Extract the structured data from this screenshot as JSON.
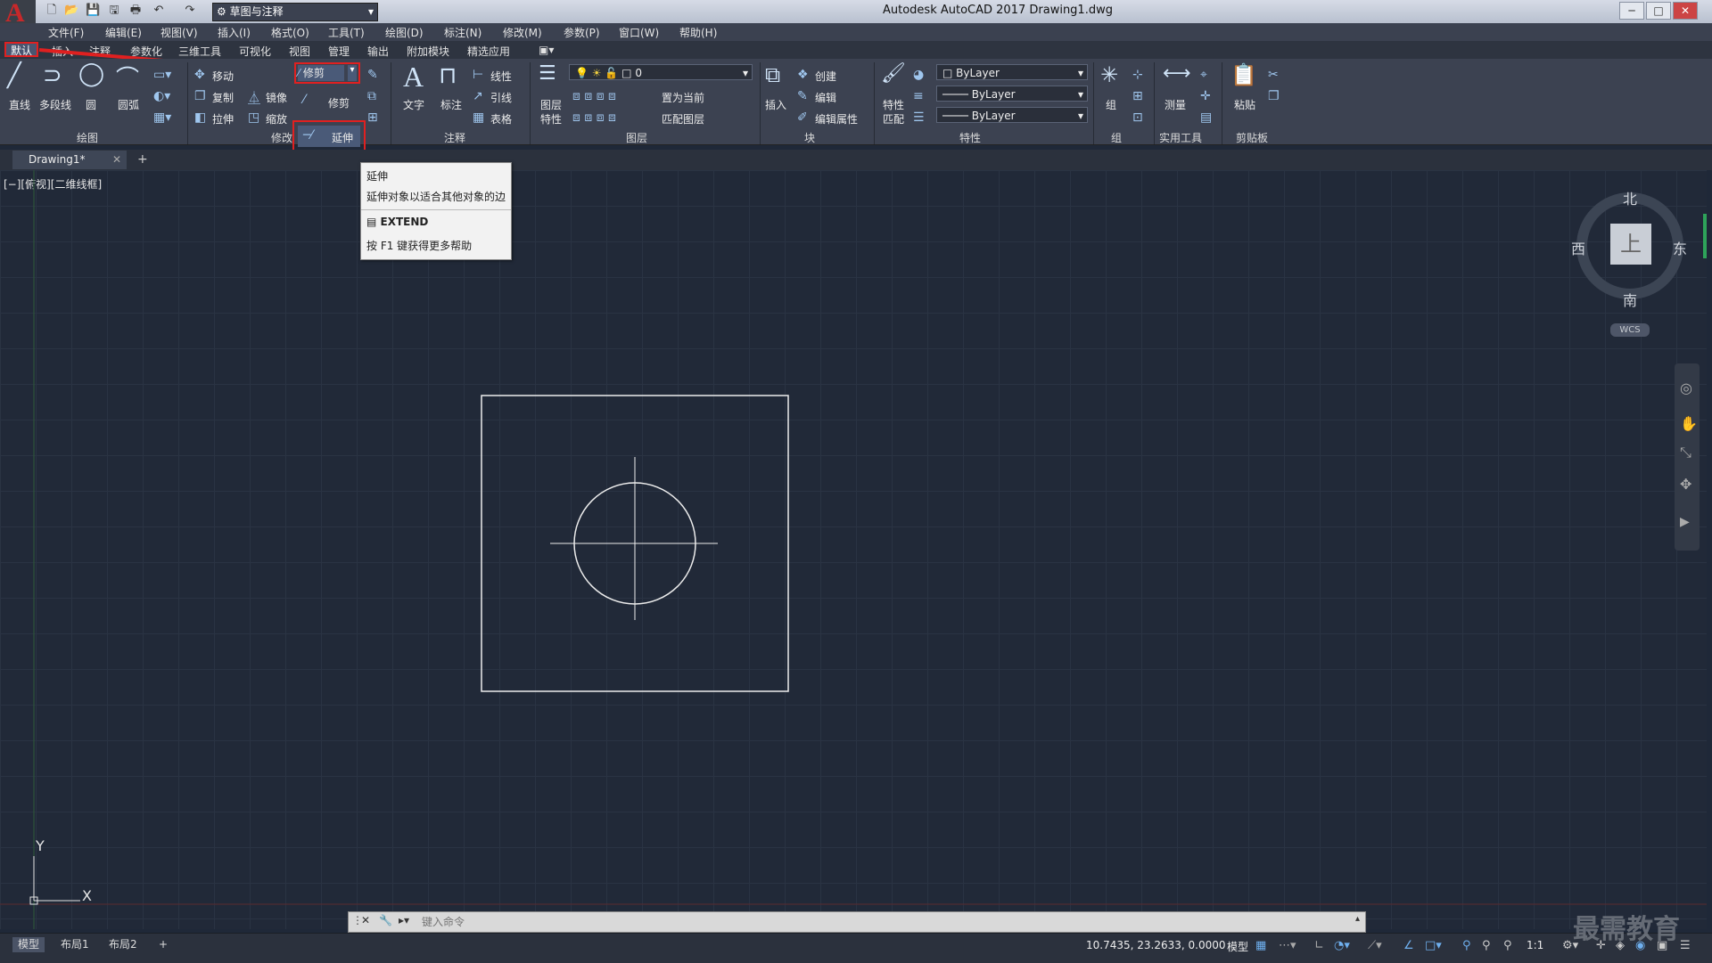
{
  "window": {
    "title": "Autodesk AutoCAD 2017    Drawing1.dwg",
    "workspace": "草图与注释",
    "min": "─",
    "max": "□",
    "close": "✕"
  },
  "menu": [
    "文件(F)",
    "编辑(E)",
    "视图(V)",
    "插入(I)",
    "格式(O)",
    "工具(T)",
    "绘图(D)",
    "标注(N)",
    "修改(M)",
    "参数(P)",
    "窗口(W)",
    "帮助(H)"
  ],
  "ribbon_tabs": [
    "默认",
    "插入",
    "注释",
    "参数化",
    "三维工具",
    "可视化",
    "视图",
    "管理",
    "输出",
    "附加模块",
    "精选应用"
  ],
  "draw_panel": {
    "line": "直线",
    "polyline": "多段线",
    "circle": "圆",
    "arc": "圆弧",
    "label": "绘图"
  },
  "modify_panel": {
    "move": "移动",
    "copy": "复制",
    "mirror": "镜像",
    "stretch": "拉伸",
    "scale": "缩放",
    "trim_top": "修剪",
    "trim": "修剪",
    "extend": "延伸",
    "label": "修改"
  },
  "annotation_panel": {
    "text": "文字",
    "dimension": "标注",
    "linear": "线性",
    "leader": "引线",
    "table": "表格",
    "label": "注释"
  },
  "layer_panel": {
    "layer_props_1": "图层",
    "layer_props_2": "特性",
    "current_layer": "0",
    "set_current": "置为当前",
    "match_layer": "匹配图层",
    "label": "图层"
  },
  "block_panel": {
    "insert": "插入",
    "create": "创建",
    "edit": "编辑",
    "edit_attr": "编辑属性",
    "label": "块"
  },
  "properties_panel": {
    "match_1": "特性",
    "match_2": "匹配",
    "color": "ByLayer",
    "linetype": "ByLayer",
    "lineweight": "ByLayer",
    "label": "特性"
  },
  "group_panel": {
    "group": "组",
    "label": "组"
  },
  "utilities_panel": {
    "measure": "测量",
    "label": "实用工具"
  },
  "clipboard_panel": {
    "paste": "粘贴",
    "label": "剪贴板"
  },
  "doc_tab": "Drawing1*",
  "viewport_label": "[−][俯视][二维线框]",
  "tooltip": {
    "title": "延伸",
    "desc": "延伸对象以适合其他对象的边",
    "command": "EXTEND",
    "help": "按 F1 键获得更多帮助"
  },
  "viewcube": {
    "north": "北",
    "south": "南",
    "east": "东",
    "west": "西",
    "top": "上",
    "wcs": "WCS"
  },
  "ucs": {
    "x": "X",
    "y": "Y"
  },
  "command_line": {
    "placeholder": "键入命令"
  },
  "layout_tabs": [
    "模型",
    "布局1",
    "布局2"
  ],
  "status": {
    "coords": "10.7435, 23.2633, 0.0000",
    "model": "模型",
    "scale": "1:1"
  },
  "watermark": "最需教育"
}
